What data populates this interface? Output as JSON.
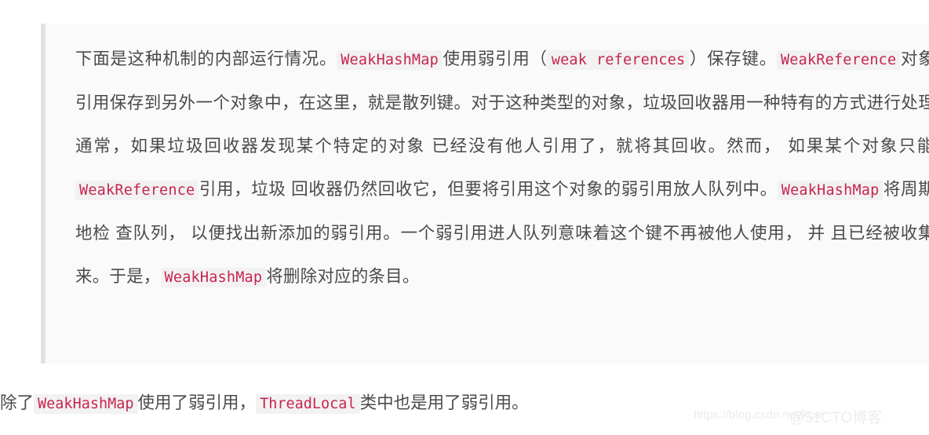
{
  "page": {
    "background_color": "#ffffff",
    "text_color": "#4a4a4a",
    "code_text_color": "#c7254e",
    "code_background_color": "#f2f2f2",
    "blockquote_background_color": "#fafafa",
    "blockquote_border_color": "#e3e3e3"
  },
  "blockquote": {
    "segments": {
      "s1": "下面是这种机制的内部运行情况。",
      "c1": "WeakHashMap",
      "s2": "使用弱引用（",
      "c2": "weak references",
      "s3": "）保存键。",
      "c3": "WeakReference",
      "s4": "对象将引用保存到另外一个对象中，在这里，就是散列键。对于这种类型的对象，垃圾回收器用一种特有的方式进行处理。通常，如果垃圾回收器发现某个特定的对象 已经没有他人引用了，就将其回收。然而， 如果某个对象只能由",
      "c4": "WeakReference",
      "s5": "引用，垃圾 回收器仍然回收它，但要将引用这个对象的弱引用放人队列中。",
      "c5": "WeakHashMap",
      "s6": "将周期性地检 查队列， 以便找出新添加的弱引用。一个弱引用进人队列意味着这个键不再被他人使用， 并 且已经被收集起来。于是，",
      "c6": "WeakHashMap",
      "s7": "将删除对应的条目。"
    }
  },
  "tail_paragraph": {
    "segments": {
      "t1": "除了",
      "tc1": "WeakHashMap",
      "t2": "使用了弱引用，",
      "tc2": "ThreadLocal",
      "t3": "类中也是用了弱引用。"
    }
  },
  "watermark": {
    "url": "https://blog.csdn.net/kuai",
    "brand": "@51CTO博客"
  }
}
